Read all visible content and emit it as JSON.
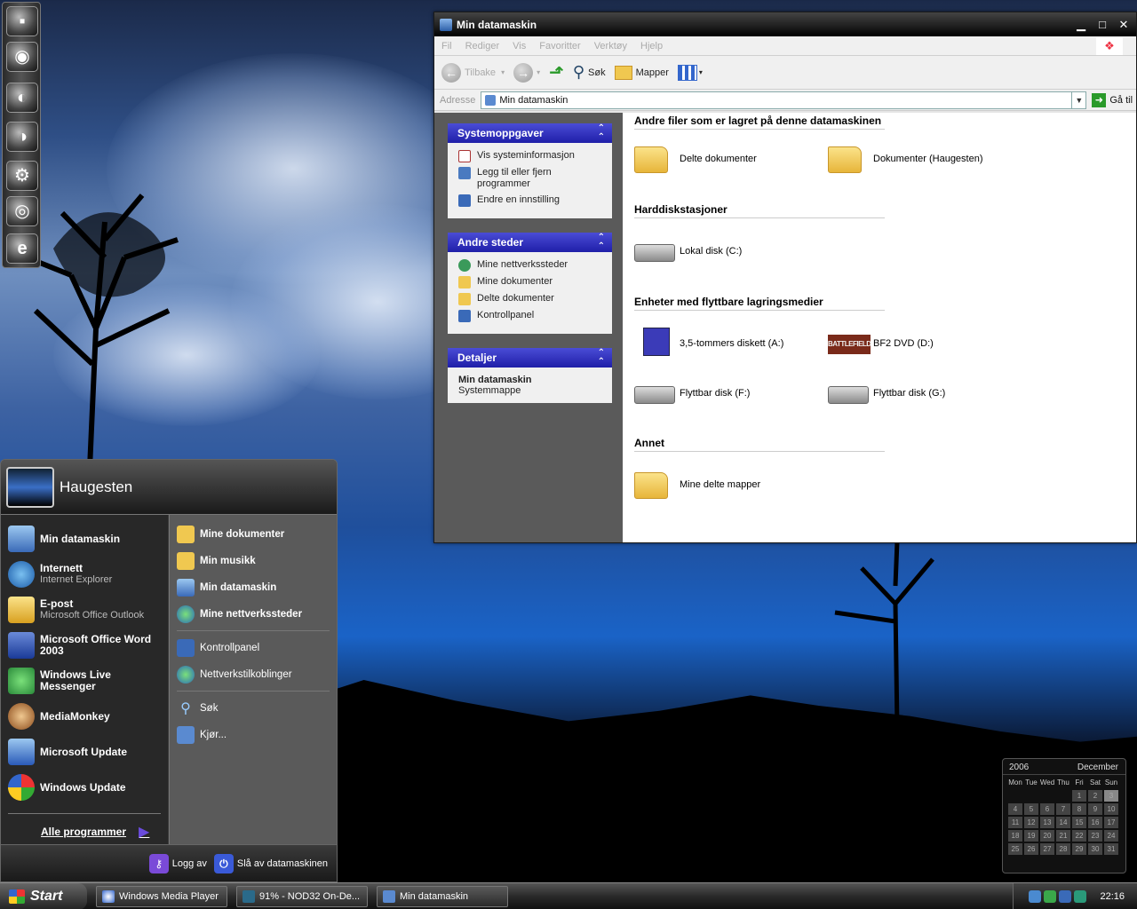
{
  "explorer": {
    "title": "Min datamaskin",
    "menu": [
      "Fil",
      "Rediger",
      "Vis",
      "Favoritter",
      "Verktøy",
      "Hjelp"
    ],
    "toolbar": {
      "back": "Tilbake",
      "search": "Søk",
      "folders": "Mapper"
    },
    "address": {
      "label": "Adresse",
      "value": "Min datamaskin",
      "go": "Gå til"
    },
    "tasks": [
      {
        "title": "Systemoppgaver",
        "links": [
          "Vis systeminformasjon",
          "Legg til eller fjern programmer",
          "Endre en innstilling"
        ]
      },
      {
        "title": "Andre steder",
        "links": [
          "Mine nettverkssteder",
          "Mine dokumenter",
          "Delte dokumenter",
          "Kontrollpanel"
        ]
      },
      {
        "title": "Detaljer",
        "detail_title": "Min datamaskin",
        "detail_sub": "Systemmappe"
      }
    ],
    "sections": [
      {
        "title": "Andre filer som er lagret på denne datamaskinen",
        "items": [
          "Delte dokumenter",
          "Dokumenter (Haugesten)"
        ]
      },
      {
        "title": "Harddiskstasjoner",
        "items": [
          "Lokal disk (C:)"
        ]
      },
      {
        "title": "Enheter med flyttbare lagringsmedier",
        "items": [
          "3,5-tommers diskett (A:)",
          "BF2 DVD (D:)",
          "Flyttbar disk (F:)",
          "Flyttbar disk (G:)"
        ]
      },
      {
        "title": "Annet",
        "items": [
          "Mine delte mapper"
        ]
      }
    ],
    "bf2_logo": "BATTLEFIELD"
  },
  "start_menu": {
    "user": "Haugesten",
    "pinned": [
      {
        "label": "Min datamaskin",
        "sub": ""
      },
      {
        "label": "Internett",
        "sub": "Internet Explorer"
      },
      {
        "label": "E-post",
        "sub": "Microsoft Office Outlook"
      },
      {
        "label": "Microsoft Office Word 2003",
        "sub": ""
      },
      {
        "label": "Windows Live Messenger",
        "sub": ""
      },
      {
        "label": "MediaMonkey",
        "sub": ""
      },
      {
        "label": "Microsoft Update",
        "sub": ""
      },
      {
        "label": "Windows Update",
        "sub": ""
      }
    ],
    "all_programs": "Alle programmer",
    "right": [
      {
        "label": "Mine dokumenter",
        "bold": true
      },
      {
        "label": "Min musikk",
        "bold": true
      },
      {
        "label": "Min datamaskin",
        "bold": true
      },
      {
        "label": "Mine nettverkssteder",
        "bold": true
      },
      {
        "label": "Kontrollpanel",
        "bold": false
      },
      {
        "label": "Nettverkstilkoblinger",
        "bold": false
      },
      {
        "label": "Søk",
        "bold": false
      },
      {
        "label": "Kjør...",
        "bold": false
      }
    ],
    "logoff": "Logg av",
    "shutdown": "Slå av datamaskinen"
  },
  "calendar": {
    "year": "2006",
    "month": "December",
    "weekdays": [
      "Mon",
      "Tue",
      "Wed",
      "Thu",
      "Fri",
      "Sat",
      "Sun"
    ],
    "days": [
      "",
      "",
      "",
      "",
      "1",
      "2",
      "3",
      "4",
      "5",
      "6",
      "7",
      "8",
      "9",
      "10",
      "11",
      "12",
      "13",
      "14",
      "15",
      "16",
      "17",
      "18",
      "19",
      "20",
      "21",
      "22",
      "23",
      "24",
      "25",
      "26",
      "27",
      "28",
      "29",
      "30",
      "31"
    ],
    "today": "3"
  },
  "taskbar": {
    "start": "Start",
    "tasks": [
      "Windows Media Player",
      "91% - NOD32 On-De...",
      "Min datamaskin"
    ],
    "clock": "22:16"
  },
  "colors": {
    "panel_header": "#2b2bc0",
    "folder": "#f0c850"
  }
}
